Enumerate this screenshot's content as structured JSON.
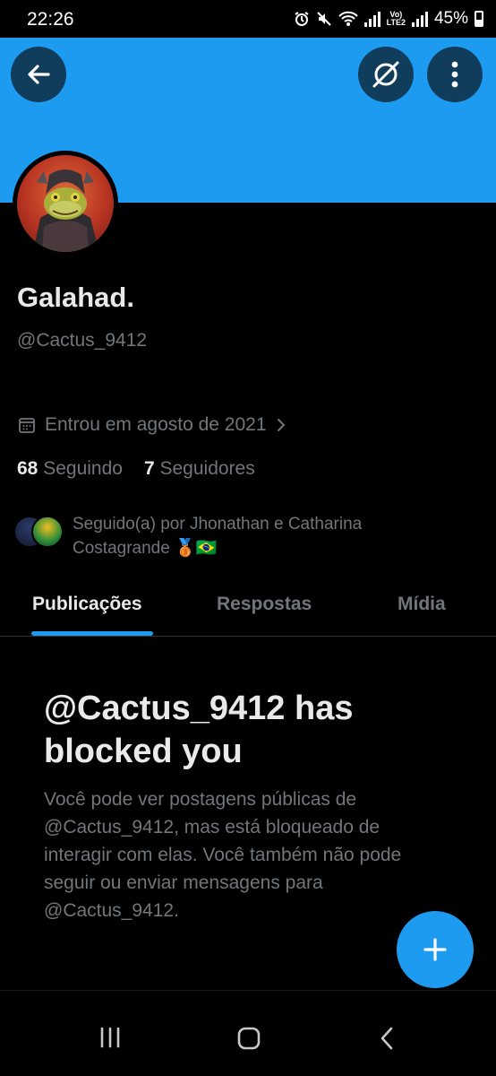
{
  "status_bar": {
    "time": "22:26",
    "battery": "45%",
    "icons": [
      "alarm-icon",
      "mute-icon",
      "wifi-icon",
      "signal-icon",
      "volte-icon",
      "battery-icon"
    ],
    "volte_top": "Vo)",
    "volte_bottom": "LTE2"
  },
  "profile": {
    "name": "Galahad.",
    "handle": "@Cactus_9412",
    "joined": "Entrou em agosto de 2021",
    "following_count": "68",
    "following_label": "Seguindo",
    "followers_count": "7",
    "followers_label": "Seguidores",
    "followed_by": "Seguido(a) por Jhonathan e Catharina Costagrande 🥉🇧🇷"
  },
  "tabs": [
    {
      "label": "Publicações",
      "active": true
    },
    {
      "label": "Respostas",
      "active": false
    },
    {
      "label": "Mídia",
      "active": false
    }
  ],
  "blocked": {
    "title": "@Cactus_9412 has blocked you",
    "body": "Você pode ver postagens públicas de @Cactus_9412, mas está bloqueado de interagir com elas. Você também não pode seguir ou enviar mensagens para @Cactus_9412."
  },
  "colors": {
    "accent": "#1d9bf0",
    "background": "#000000",
    "text_primary": "#e7e9ea",
    "text_secondary": "#71767b"
  }
}
